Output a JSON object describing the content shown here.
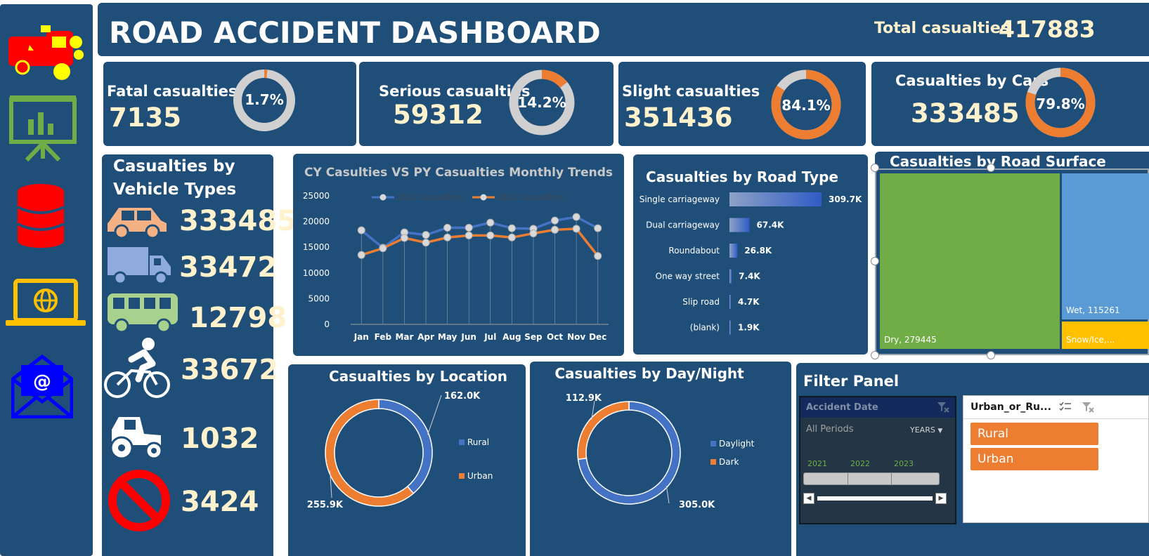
{
  "header": {
    "title": "ROAD ACCIDENT DASHBOARD",
    "total_label": "Total casualties",
    "total_value": "417883"
  },
  "kpis": [
    {
      "title": "Fatal casualties",
      "value": "7135",
      "percent_label": "1.7%",
      "percent": 1.7
    },
    {
      "title": "Serious casualties",
      "value": "59312",
      "percent_label": "14.2%",
      "percent": 14.2
    },
    {
      "title": "Slight casualties",
      "value": "351436",
      "percent_label": "84.1%",
      "percent": 84.1
    },
    {
      "title": "Casualties by Cars",
      "value": "333485",
      "percent_label": "79.8%",
      "percent": 79.8
    }
  ],
  "vehicles": {
    "title_line1": "Casualties by",
    "title_line2": "Vehicle Types",
    "items": [
      {
        "icon": "car-icon",
        "value": "333485",
        "color": "#f4b183"
      },
      {
        "icon": "truck-icon",
        "value": "33472",
        "color": "#8faadc"
      },
      {
        "icon": "bus-icon",
        "value": "12798",
        "color": "#a9d18e"
      },
      {
        "icon": "bicycle-icon",
        "value": "33672",
        "color": "#ffffff"
      },
      {
        "icon": "tractor-icon",
        "value": "1032",
        "color": "#ffffff"
      },
      {
        "icon": "no-entry-icon",
        "value": "3424",
        "color": "#ff0000"
      }
    ]
  },
  "sidebar": {
    "icons": [
      "fire-truck-icon",
      "presentation-chart-icon",
      "database-icon",
      "laptop-globe-icon",
      "email-icon"
    ]
  },
  "colors": {
    "panel": "#1f4e79",
    "accent_orange": "#ed7d31",
    "accent_blue": "#4472c4",
    "cream": "#fff2cc",
    "ring_gray": "#d0d0d0"
  },
  "chart_data": [
    {
      "id": "monthly_trend",
      "type": "line",
      "title": "CY Casulties VS PY Casualties Monthly Trends",
      "categories": [
        "Jan",
        "Feb",
        "Mar",
        "Apr",
        "May",
        "Jun",
        "Jul",
        "Aug",
        "Sep",
        "Oct",
        "Nov",
        "Dec"
      ],
      "series": [
        {
          "name": "2021 Casualties",
          "color": "#4472c4",
          "values": [
            18300,
            14900,
            17900,
            17400,
            18800,
            18800,
            19800,
            18700,
            18600,
            20200,
            20900,
            18700
          ]
        },
        {
          "name": "2022 Casualties",
          "color": "#ed7d31",
          "values": [
            13500,
            14800,
            16800,
            15900,
            16900,
            17300,
            17300,
            16900,
            17700,
            18400,
            18600,
            13300
          ]
        }
      ],
      "yticks": [
        0,
        5000,
        10000,
        15000,
        20000,
        25000
      ],
      "ylim": [
        0,
        25000
      ],
      "legend": "top"
    },
    {
      "id": "road_type",
      "type": "bar",
      "title": "Casualties by Road Type",
      "categories": [
        "Single carriageway",
        "Dual carriageway",
        "Roundabout",
        "One way street",
        "Slip road",
        "(blank)"
      ],
      "values": [
        309.7,
        67.4,
        26.8,
        7.4,
        4.7,
        1.9
      ],
      "labels": [
        "309.7K",
        "67.4K",
        "26.8K",
        "7.4K",
        "4.7K",
        "1.9K"
      ],
      "orientation": "horizontal"
    },
    {
      "id": "road_surface",
      "type": "treemap",
      "title": "Casualties by Road Surface",
      "items": [
        {
          "label": "Dry, 279445",
          "value": 279445,
          "color": "#70ad47"
        },
        {
          "label": "Wet, 115261",
          "value": 115261,
          "color": "#5b9bd5"
        },
        {
          "label": "Snow/Ice,...",
          "value": 23177,
          "color": "#ffc000"
        }
      ]
    },
    {
      "id": "location",
      "type": "pie",
      "subtype": "donut",
      "title": "Casualties by Location",
      "labels": [
        "Rural",
        "Urban"
      ],
      "values": [
        162.0,
        255.9
      ],
      "value_labels": [
        "162.0K",
        "255.9K"
      ],
      "colors": [
        "#4472c4",
        "#ed7d31"
      ],
      "legend": "right"
    },
    {
      "id": "day_night",
      "type": "pie",
      "subtype": "donut",
      "title": "Casualties by Day/Night",
      "labels": [
        "Daylight",
        "Dark"
      ],
      "values": [
        305.0,
        112.9
      ],
      "value_labels": [
        "305.0K",
        "112.9K"
      ],
      "colors": [
        "#4472c4",
        "#ed7d31"
      ],
      "legend": "right"
    }
  ],
  "filter_panel": {
    "title": "Filter Panel",
    "timeline": {
      "header": "Accident Date",
      "periods": "All Periods",
      "unit": "YEARS",
      "years": [
        "2021",
        "2022",
        "2023"
      ]
    },
    "slicer": {
      "header": "Urban_or_Ru...",
      "items": [
        "Rural",
        "Urban"
      ]
    }
  }
}
